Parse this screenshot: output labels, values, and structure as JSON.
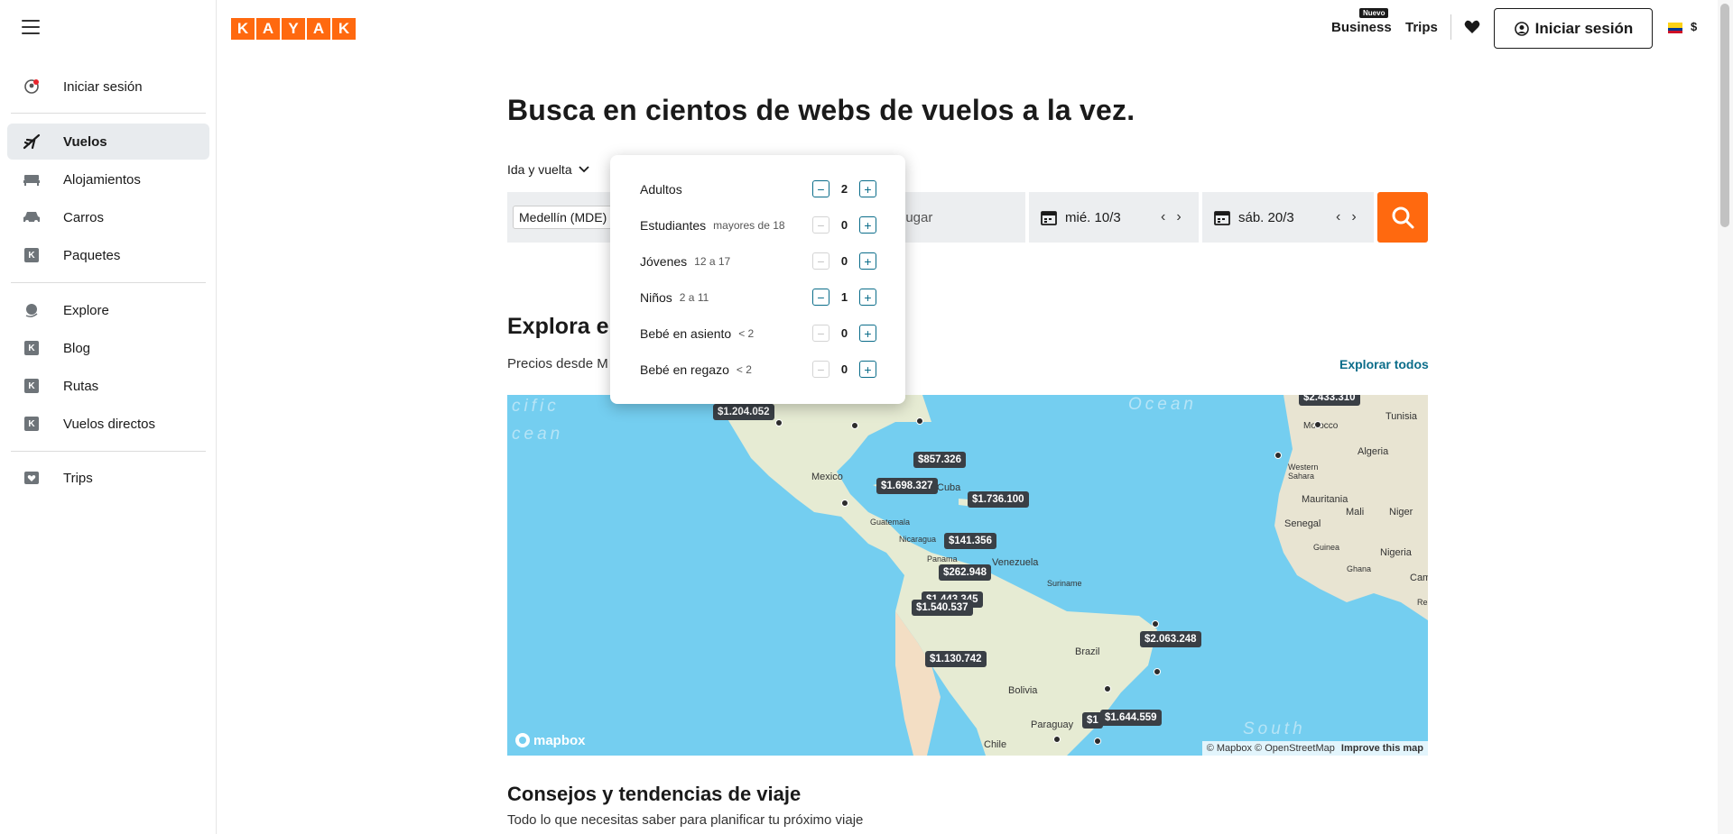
{
  "sidebar": {
    "items": [
      {
        "label": "Iniciar sesión",
        "icon": "user-notification-icon"
      },
      {
        "label": "Vuelos",
        "icon": "plane-icon",
        "active": true
      },
      {
        "label": "Alojamientos",
        "icon": "bed-icon"
      },
      {
        "label": "Carros",
        "icon": "car-icon"
      },
      {
        "label": "Paquetes",
        "icon": "kayak-k-icon"
      },
      {
        "label": "Explore",
        "icon": "globe-icon"
      },
      {
        "label": "Blog",
        "icon": "kayak-k-icon"
      },
      {
        "label": "Rutas",
        "icon": "kayak-k-icon"
      },
      {
        "label": "Vuelos directos",
        "icon": "kayak-k-icon"
      },
      {
        "label": "Trips",
        "icon": "trips-heart-icon"
      }
    ]
  },
  "header": {
    "logo_letters": [
      "K",
      "A",
      "Y",
      "A",
      "K"
    ],
    "business": "Business",
    "nuevo_badge": "Nuevo",
    "trips": "Trips",
    "login": "Iniciar sesión",
    "currency": "$"
  },
  "hero": {
    "title": "Busca en cientos de webs de vuelos a la vez.",
    "trip_type": "Ida y vuelta",
    "origin": "Medellín (MDE)",
    "destination_placeholder": "lugar",
    "depart_date": "mié. 10/3",
    "return_date": "sáb. 20/3"
  },
  "passengers": [
    {
      "label": "Adultos",
      "sub": "",
      "value": "2",
      "minus_enabled": true
    },
    {
      "label": "Estudiantes",
      "sub": "mayores de 18",
      "value": "0",
      "minus_enabled": false
    },
    {
      "label": "Jóvenes",
      "sub": "12 a 17",
      "value": "0",
      "minus_enabled": false
    },
    {
      "label": "Niños",
      "sub": "2 a 11",
      "value": "1",
      "minus_enabled": true
    },
    {
      "label": "Bebé en asiento",
      "sub": "< 2",
      "value": "0",
      "minus_enabled": false
    },
    {
      "label": "Bebé en regazo",
      "sub": "< 2",
      "value": "0",
      "minus_enabled": false
    }
  ],
  "explore": {
    "title": "Explora el",
    "subtitle": "Precios desde M",
    "explore_all": "Explorar todos"
  },
  "map": {
    "prices": [
      "$1.204.052",
      "$857.326",
      "$1.698.327",
      "$1.736.100",
      "$141.356",
      "$262.948",
      "$1.443.345",
      "$1.540.537",
      "$2.063.248",
      "$1.130.742",
      "$1.644.559",
      "$1",
      "$2.433.310"
    ],
    "labels": [
      "Mexico",
      "Cuba",
      "Guatemala",
      "Nicaragua",
      "Panama",
      "Venezuela",
      "Suriname",
      "Brazil",
      "Bolivia",
      "Paraguay",
      "Chile",
      "Morocco",
      "Tunisia",
      "Algeria",
      "Western Sahara",
      "Mauritania",
      "Mali",
      "Niger",
      "Senegal",
      "Guinea",
      "Ghana",
      "Nigeria",
      "Camero",
      "Re"
    ],
    "ocean_labels": [
      "cific",
      "cean",
      "Ocean",
      "South"
    ],
    "brand": "mapbox",
    "attribution": "© Mapbox © OpenStreetMap",
    "improve": "Improve this map"
  },
  "tips": {
    "title": "Consejos y tendencias de viaje",
    "subtitle": "Todo lo que necesitas saber para planificar tu próximo viaje"
  },
  "colors": {
    "brand": "#ff690f",
    "link": "#0b6d8a",
    "ocean": "#74cef0",
    "land": "#e8ecd6"
  }
}
